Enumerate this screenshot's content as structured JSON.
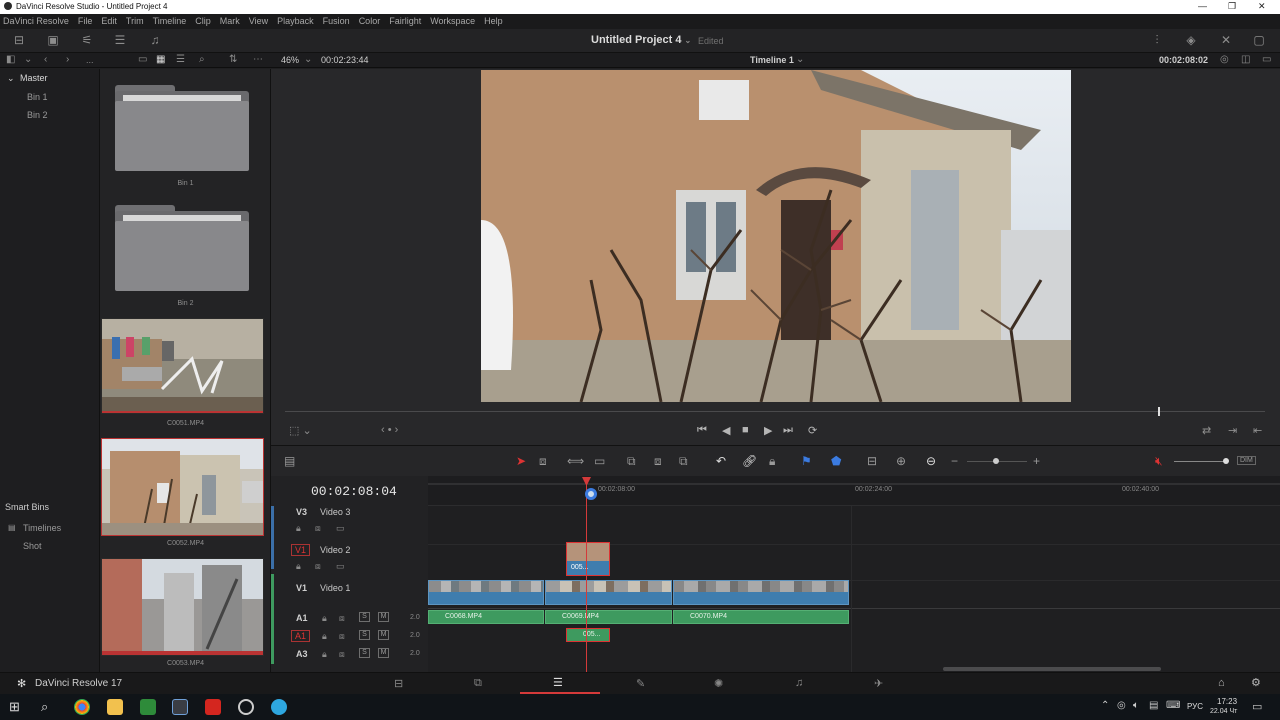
{
  "window": {
    "title": "DaVinci Resolve Studio - Untitled Project 4",
    "controls": [
      "—",
      "❐",
      "✕"
    ]
  },
  "menu": [
    "DaVinci Resolve",
    "File",
    "Edit",
    "Trim",
    "Timeline",
    "Clip",
    "Mark",
    "View",
    "Playback",
    "Fusion",
    "Color",
    "Fairlight",
    "Workspace",
    "Help"
  ],
  "toolbar": {
    "project_name": "Untitled Project 4",
    "project_caret": "⌄",
    "status": "Edited"
  },
  "subbar": {
    "zoom": "46%",
    "source_timecode": "00:02:23:44",
    "timeline_name": "Timeline 1",
    "record_timecode": "00:02:08:02",
    "more": "..."
  },
  "bins": {
    "master": "Master",
    "items": [
      "Bin 1",
      "Bin 2"
    ],
    "smart_bins": "Smart Bins",
    "smart_items": [
      "Timelines",
      "Shot"
    ]
  },
  "media_pool": {
    "folders": [
      "Bin 1",
      "Bin 2"
    ],
    "clips": [
      "C0051.MP4",
      "C0052.MP4",
      "C0053.MP4"
    ]
  },
  "timeline": {
    "timecode": "00:02:08:04",
    "ruler_marks": [
      "00:02:08:00",
      "00:02:24:00",
      "00:02:40:00"
    ],
    "tracks": [
      {
        "id": "V3",
        "name": "Video 3"
      },
      {
        "id": "V1",
        "name": "Video 2"
      },
      {
        "id": "V1",
        "name": "Video 1"
      },
      {
        "id": "A1",
        "level": "2.0"
      },
      {
        "id": "A1",
        "level": "2.0"
      },
      {
        "id": "A3",
        "level": "2.0"
      }
    ],
    "audio_clips": [
      "C0068.MP4",
      "C0069.MP4",
      "C0070.MP4"
    ],
    "short_clip": "005...",
    "solo": "S",
    "mute": "M"
  },
  "pagebar": {
    "app_label": "DaVinci Resolve 17"
  },
  "taskbar": {
    "lang": "РУС",
    "time": "17:23",
    "date": "22.04 Чт"
  },
  "colors": {
    "accent_red": "#d43a3a",
    "video_clip": "#3f7dae",
    "audio_clip": "#3e9a5f"
  }
}
